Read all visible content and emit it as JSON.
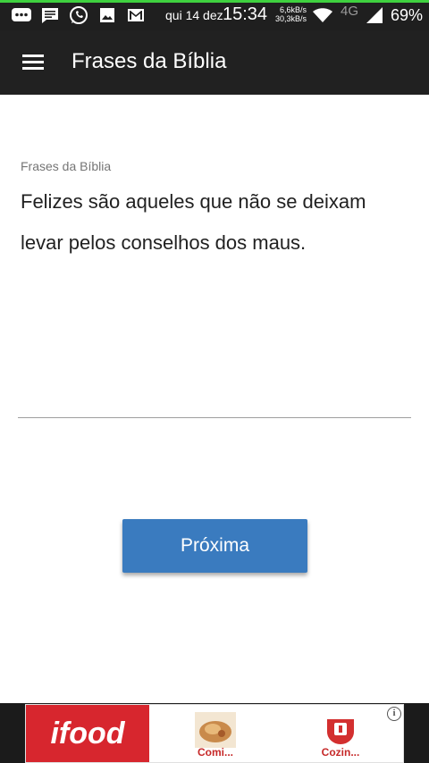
{
  "status_bar": {
    "date": "qui 14 dez",
    "time": "15:34",
    "speed_up": "6,6kB/s",
    "speed_down": "30,3kB/s",
    "network": "4G",
    "battery": "69%",
    "icons": [
      "messenger-icon",
      "message-icon",
      "whatsapp-icon",
      "gallery-icon",
      "gmail-icon",
      "wifi-icon",
      "signal-icon"
    ]
  },
  "toolbar": {
    "menu_icon": "hamburger-menu-icon",
    "title": "Frases da Bíblia"
  },
  "quote": {
    "label": "Frases da Bíblia",
    "text": "Felizes são aqueles que não se deixam levar pelos conselhos dos maus."
  },
  "actions": {
    "next_label": "Próxima"
  },
  "ad": {
    "brand": "ifood",
    "items": [
      {
        "label": "Comi..."
      },
      {
        "label": "Cozin..."
      }
    ],
    "info_icon": "info-icon"
  },
  "colors": {
    "toolbar_bg": "#212121",
    "button_bg": "#3a7bbf",
    "ad_brand": "#d7262e"
  }
}
